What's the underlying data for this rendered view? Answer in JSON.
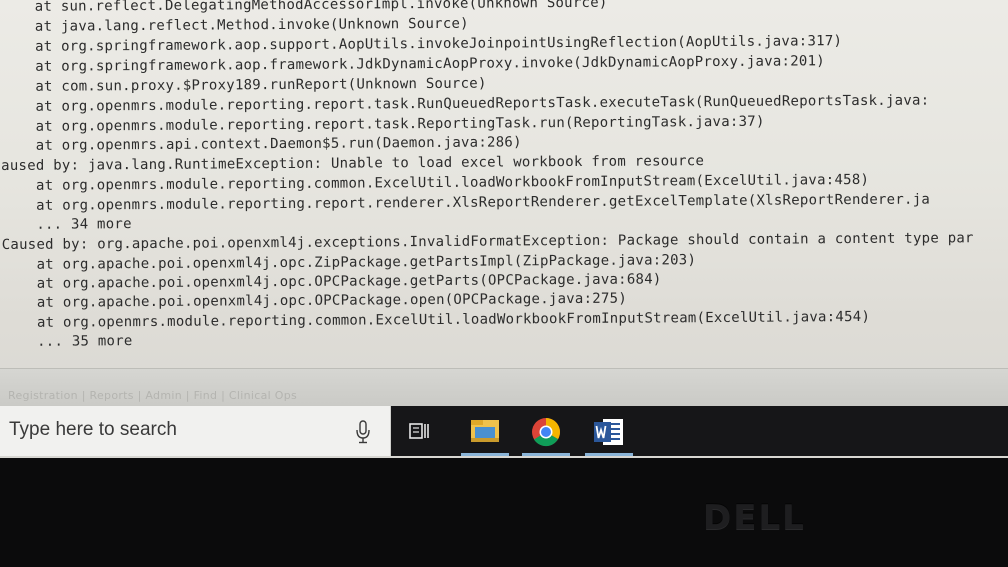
{
  "log": {
    "lines": [
      "    at sun.reflect.DelegatingMethodAccessorImpl.invoke(Unknown Source)",
      "    at java.lang.reflect.Method.invoke(Unknown Source)",
      "    at org.springframework.aop.support.AopUtils.invokeJoinpointUsingReflection(AopUtils.java:317)",
      "    at org.springframework.aop.framework.JdkDynamicAopProxy.invoke(JdkDynamicAopProxy.java:201)",
      "    at com.sun.proxy.$Proxy189.runReport(Unknown Source)",
      "    at org.openmrs.module.reporting.report.task.RunQueuedReportsTask.executeTask(RunQueuedReportsTask.java:",
      "    at org.openmrs.module.reporting.report.task.ReportingTask.run(ReportingTask.java:37)",
      "    at org.openmrs.api.context.Daemon$5.run(Daemon.java:286)",
      "aused by: java.lang.RuntimeException: Unable to load excel workbook from resource",
      "    at org.openmrs.module.reporting.common.ExcelUtil.loadWorkbookFromInputStream(ExcelUtil.java:458)",
      "    at org.openmrs.module.reporting.report.renderer.XlsReportRenderer.getExcelTemplate(XlsReportRenderer.ja",
      "    ... 34 more",
      "Caused by: org.apache.poi.openxml4j.exceptions.InvalidFormatException: Package should contain a content type par",
      "    at org.apache.poi.openxml4j.opc.ZipPackage.getPartsImpl(ZipPackage.java:203)",
      "    at org.apache.poi.openxml4j.opc.OPCPackage.getParts(OPCPackage.java:684)",
      "    at org.apache.poi.openxml4j.opc.OPCPackage.open(OPCPackage.java:275)",
      "    at org.openmrs.module.reporting.common.ExcelUtil.loadWorkbookFromInputStream(ExcelUtil.java:454)",
      "    ... 35 more"
    ]
  },
  "status_band": {
    "text": "Registration | Reports | Admin | Find | Clinical Ops"
  },
  "taskbar": {
    "search_placeholder": "Type here to search",
    "icons": {
      "mic": "microphone-icon",
      "task_view": "task-view-icon",
      "explorer": "file-explorer-icon",
      "chrome": "chrome-icon",
      "word": "word-icon"
    },
    "accent": "#8ab4d8"
  },
  "bezel": {
    "brand": "DELL"
  }
}
